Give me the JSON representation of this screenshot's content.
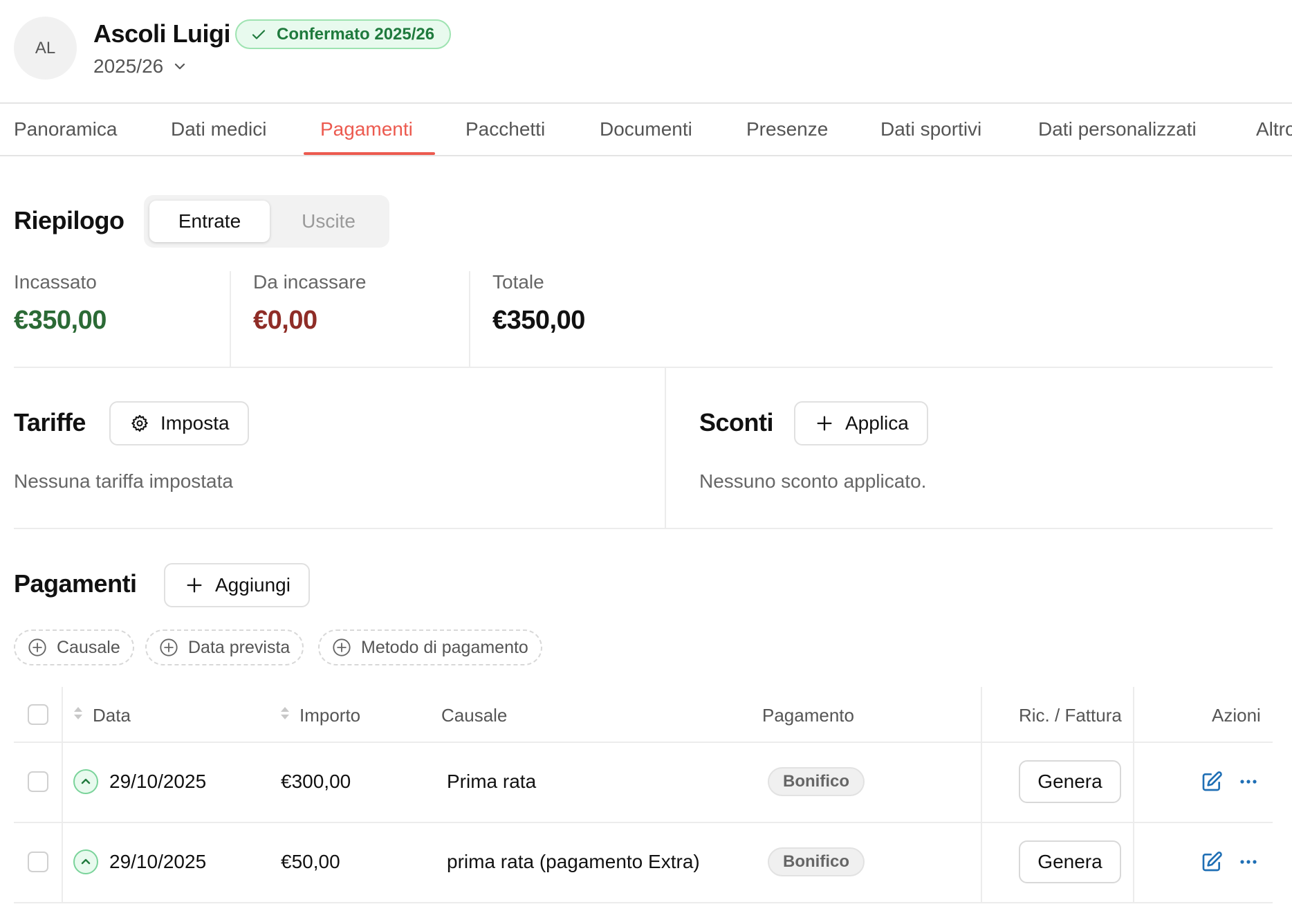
{
  "header": {
    "avatar_initials": "AL",
    "name": "Ascoli Luigi",
    "status_badge": "Confermato 2025/26",
    "season": "2025/26"
  },
  "tabs": [
    {
      "label": "Panoramica"
    },
    {
      "label": "Dati medici"
    },
    {
      "label": "Pagamenti",
      "active": true
    },
    {
      "label": "Pacchetti"
    },
    {
      "label": "Documenti"
    },
    {
      "label": "Presenze"
    },
    {
      "label": "Dati sportivi"
    },
    {
      "label": "Dati personalizzati"
    },
    {
      "label": "Altro"
    }
  ],
  "summary": {
    "title": "Riepilogo",
    "toggle": {
      "selected": "Entrate",
      "other": "Uscite"
    },
    "kpis": [
      {
        "label": "Incassato",
        "value": "€350,00",
        "color": "#2b6a35"
      },
      {
        "label": "Da incassare",
        "value": "€0,00",
        "color": "#8f2d27"
      },
      {
        "label": "Totale",
        "value": "€350,00",
        "color": "#111111"
      }
    ]
  },
  "tariffe": {
    "title": "Tariffe",
    "button": "Imposta",
    "empty": "Nessuna tariffa impostata"
  },
  "sconti": {
    "title": "Sconti",
    "button": "Applica",
    "empty": "Nessuno sconto applicato."
  },
  "pagamenti": {
    "title": "Pagamenti",
    "add_button": "Aggiungi",
    "filters": [
      "Causale",
      "Data prevista",
      "Metodo di pagamento"
    ],
    "columns": {
      "data": "Data",
      "importo": "Importo",
      "causale": "Causale",
      "pagamento": "Pagamento",
      "ricevuta": "Ric. / Fattura",
      "azioni": "Azioni"
    },
    "rows": [
      {
        "data": "29/10/2025",
        "importo": "€300,00",
        "causale": "Prima rata",
        "metodo": "Bonifico",
        "action": "Genera"
      },
      {
        "data": "29/10/2025",
        "importo": "€50,00",
        "causale": "prima rata (pagamento Extra)",
        "metodo": "Bonifico",
        "action": "Genera"
      }
    ]
  },
  "colors": {
    "accent": "#ec5a4f",
    "badge_green": "#1f7a3d",
    "icon_blue": "#1f6fb5"
  }
}
